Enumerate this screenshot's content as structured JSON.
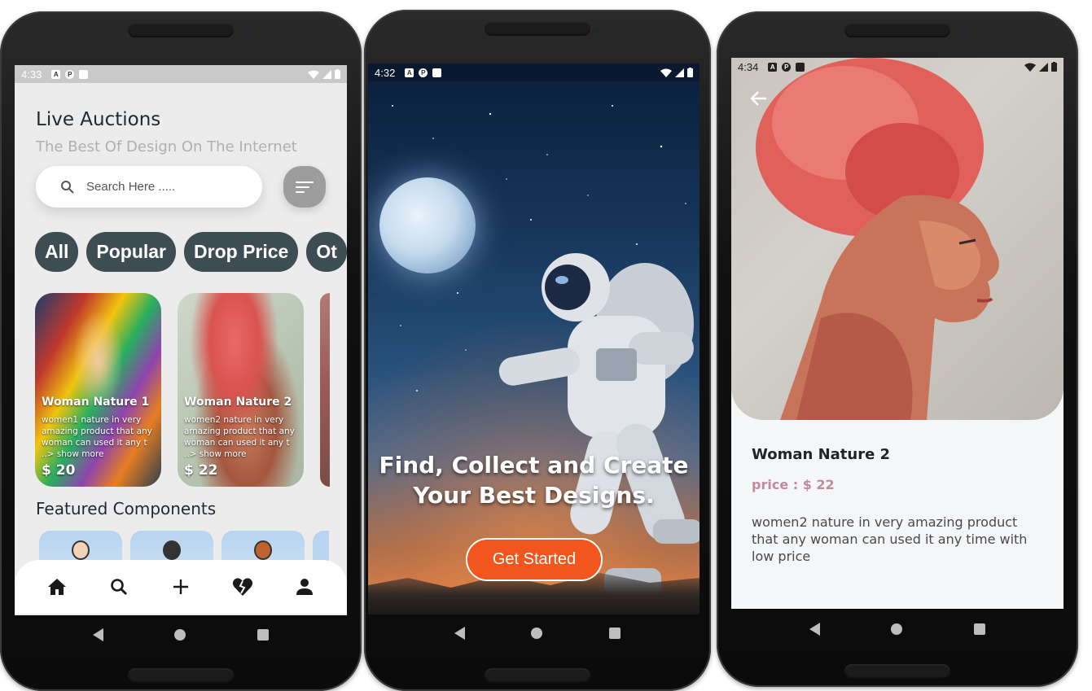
{
  "phone1": {
    "status": {
      "time": "4:33"
    },
    "title": "Live Auctions",
    "subtitle": "The Best Of Design On The Internet",
    "search": {
      "placeholder": "Search Here ....."
    },
    "chips": [
      "All",
      "Popular",
      "Drop Price",
      "Ot"
    ],
    "cards": [
      {
        "name": "Woman Nature 1",
        "desc": "women1 nature in very amazing product that any woman can used it any t ..> show more",
        "price": "$ 20"
      },
      {
        "name": "Woman Nature 2",
        "desc": "women2 nature in very amazing product that any woman can used it any t ..> show more",
        "price": "$ 22"
      }
    ],
    "featured_title": "Featured Components",
    "bottom_nav": [
      "home-icon",
      "search-icon",
      "add-icon",
      "heart-broken-icon",
      "profile-icon"
    ]
  },
  "phone2": {
    "status": {
      "time": "4:32"
    },
    "hero_line1": "Find, Collect and Create",
    "hero_line2": "Your Best Designs.",
    "cta": "Get Started"
  },
  "phone3": {
    "status": {
      "time": "4:34"
    },
    "title": "Woman Nature 2",
    "price": "price : $ 22",
    "description": "women2 nature in very amazing product that any woman can used it any time with low price"
  },
  "colors": {
    "chip": "#3e4c54",
    "cta": "#f2561d",
    "price_accent": "#c08b9a"
  }
}
